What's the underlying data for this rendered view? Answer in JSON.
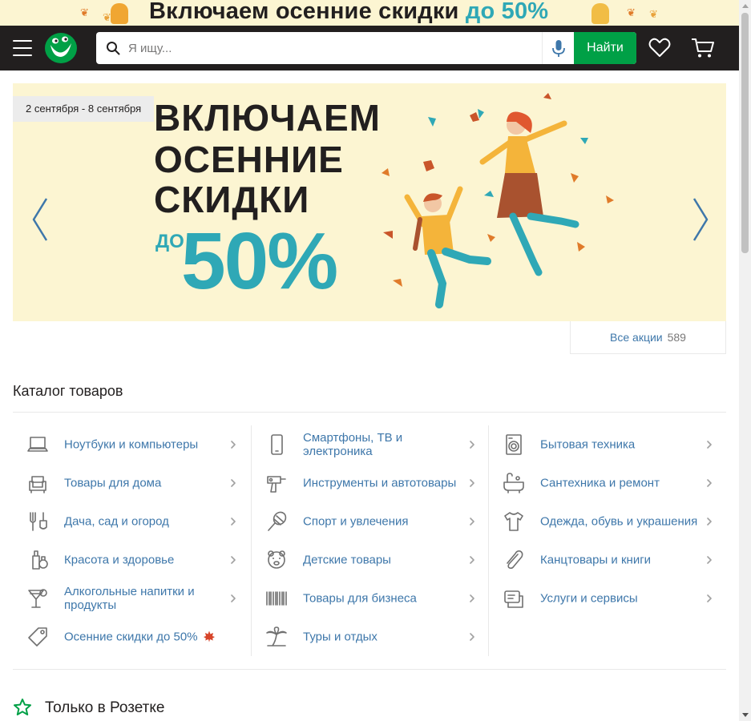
{
  "top_banner": {
    "text": "Включаем осенние скидки",
    "accent": "до 50%"
  },
  "header": {
    "search_placeholder": "Я ищу...",
    "search_button": "Найти"
  },
  "hero": {
    "dates": "2 сентября - 8 сентября",
    "line1": "ВКЛЮЧАЕМ",
    "line2": "ОСЕННИЕ",
    "line3": "СКИДКИ",
    "prefix": "ДО",
    "percent": "50%"
  },
  "promo": {
    "label": "Все акции",
    "count": "589"
  },
  "catalog": {
    "title": "Каталог товаров",
    "columns": [
      [
        {
          "label": "Ноутбуки и компьютеры",
          "icon": "laptop-icon"
        },
        {
          "label": "Товары для дома",
          "icon": "armchair-icon"
        },
        {
          "label": "Дача, сад и огород",
          "icon": "garden-tools-icon"
        },
        {
          "label": "Красота и здоровье",
          "icon": "cosmetics-icon"
        },
        {
          "label": "Алкогольные напитки и продукты",
          "icon": "cocktail-icon"
        },
        {
          "label": "Осенние скидки до 50%",
          "icon": "tag-icon"
        }
      ],
      [
        {
          "label": "Смартфоны, ТВ и электроника",
          "icon": "smartphone-icon"
        },
        {
          "label": "Инструменты и автотовары",
          "icon": "drill-icon"
        },
        {
          "label": "Спорт и увлечения",
          "icon": "racket-icon"
        },
        {
          "label": "Детские товары",
          "icon": "teddy-bear-icon"
        },
        {
          "label": "Товары для бизнеса",
          "icon": "barcode-icon"
        },
        {
          "label": "Туры и отдых",
          "icon": "palm-tree-icon"
        }
      ],
      [
        {
          "label": "Бытовая техника",
          "icon": "washing-machine-icon"
        },
        {
          "label": "Сантехника и ремонт",
          "icon": "bathtub-icon"
        },
        {
          "label": "Одежда, обувь и украшения",
          "icon": "tshirt-icon"
        },
        {
          "label": "Канцтовары и книги",
          "icon": "paperclip-icon"
        },
        {
          "label": "Услуги и сервисы",
          "icon": "services-icon"
        }
      ]
    ]
  },
  "only_section": {
    "title": "Только в Розетке"
  },
  "colors": {
    "header_bg": "#221f1f",
    "accent_green": "#00a046",
    "link_blue": "#3e77aa",
    "banner_bg": "#fcf5d2",
    "teal": "#2fa8b6"
  }
}
